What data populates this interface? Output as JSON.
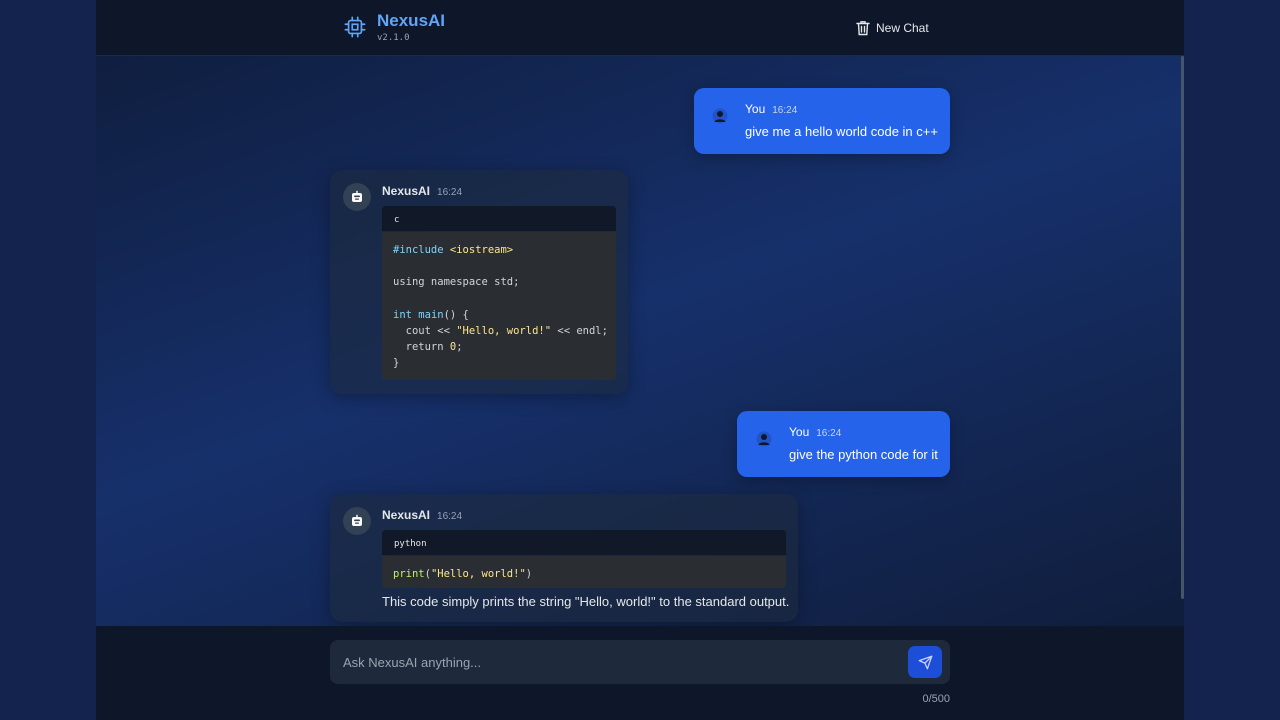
{
  "app": {
    "name": "NexusAI",
    "version": "v2.1.0"
  },
  "header": {
    "new_chat_label": "New Chat"
  },
  "messages": [
    {
      "role": "user",
      "sender": "You",
      "time": "16:24",
      "text": "give me a hello world code in c++"
    },
    {
      "role": "assistant",
      "sender": "NexusAI",
      "time": "16:24",
      "code_language": "c",
      "code_lines": [
        "#include <iostream>",
        "",
        "using namespace std;",
        "",
        "int main() {",
        "  cout << \"Hello, world!\" << endl;",
        "  return 0;",
        "}"
      ]
    },
    {
      "role": "user",
      "sender": "You",
      "time": "16:24",
      "text": "give the python code for it"
    },
    {
      "role": "assistant",
      "sender": "NexusAI",
      "time": "16:24",
      "code_language": "python",
      "code_lines": [
        "print(\"Hello, world!\")"
      ],
      "text": "This code simply prints the string \"Hello, world!\" to the standard output."
    }
  ],
  "composer": {
    "placeholder": "Ask NexusAI anything...",
    "value": "",
    "counter": "0/500"
  },
  "icons": {
    "brand": "cpu-chip-icon",
    "new_chat": "trash-icon",
    "user_avatar": "user-icon",
    "ai_avatar": "robot-icon",
    "send": "send-icon"
  },
  "colors": {
    "accent": "#60a5fa",
    "user_bubble": "#2563eb",
    "send_button": "#1d4ed8"
  }
}
